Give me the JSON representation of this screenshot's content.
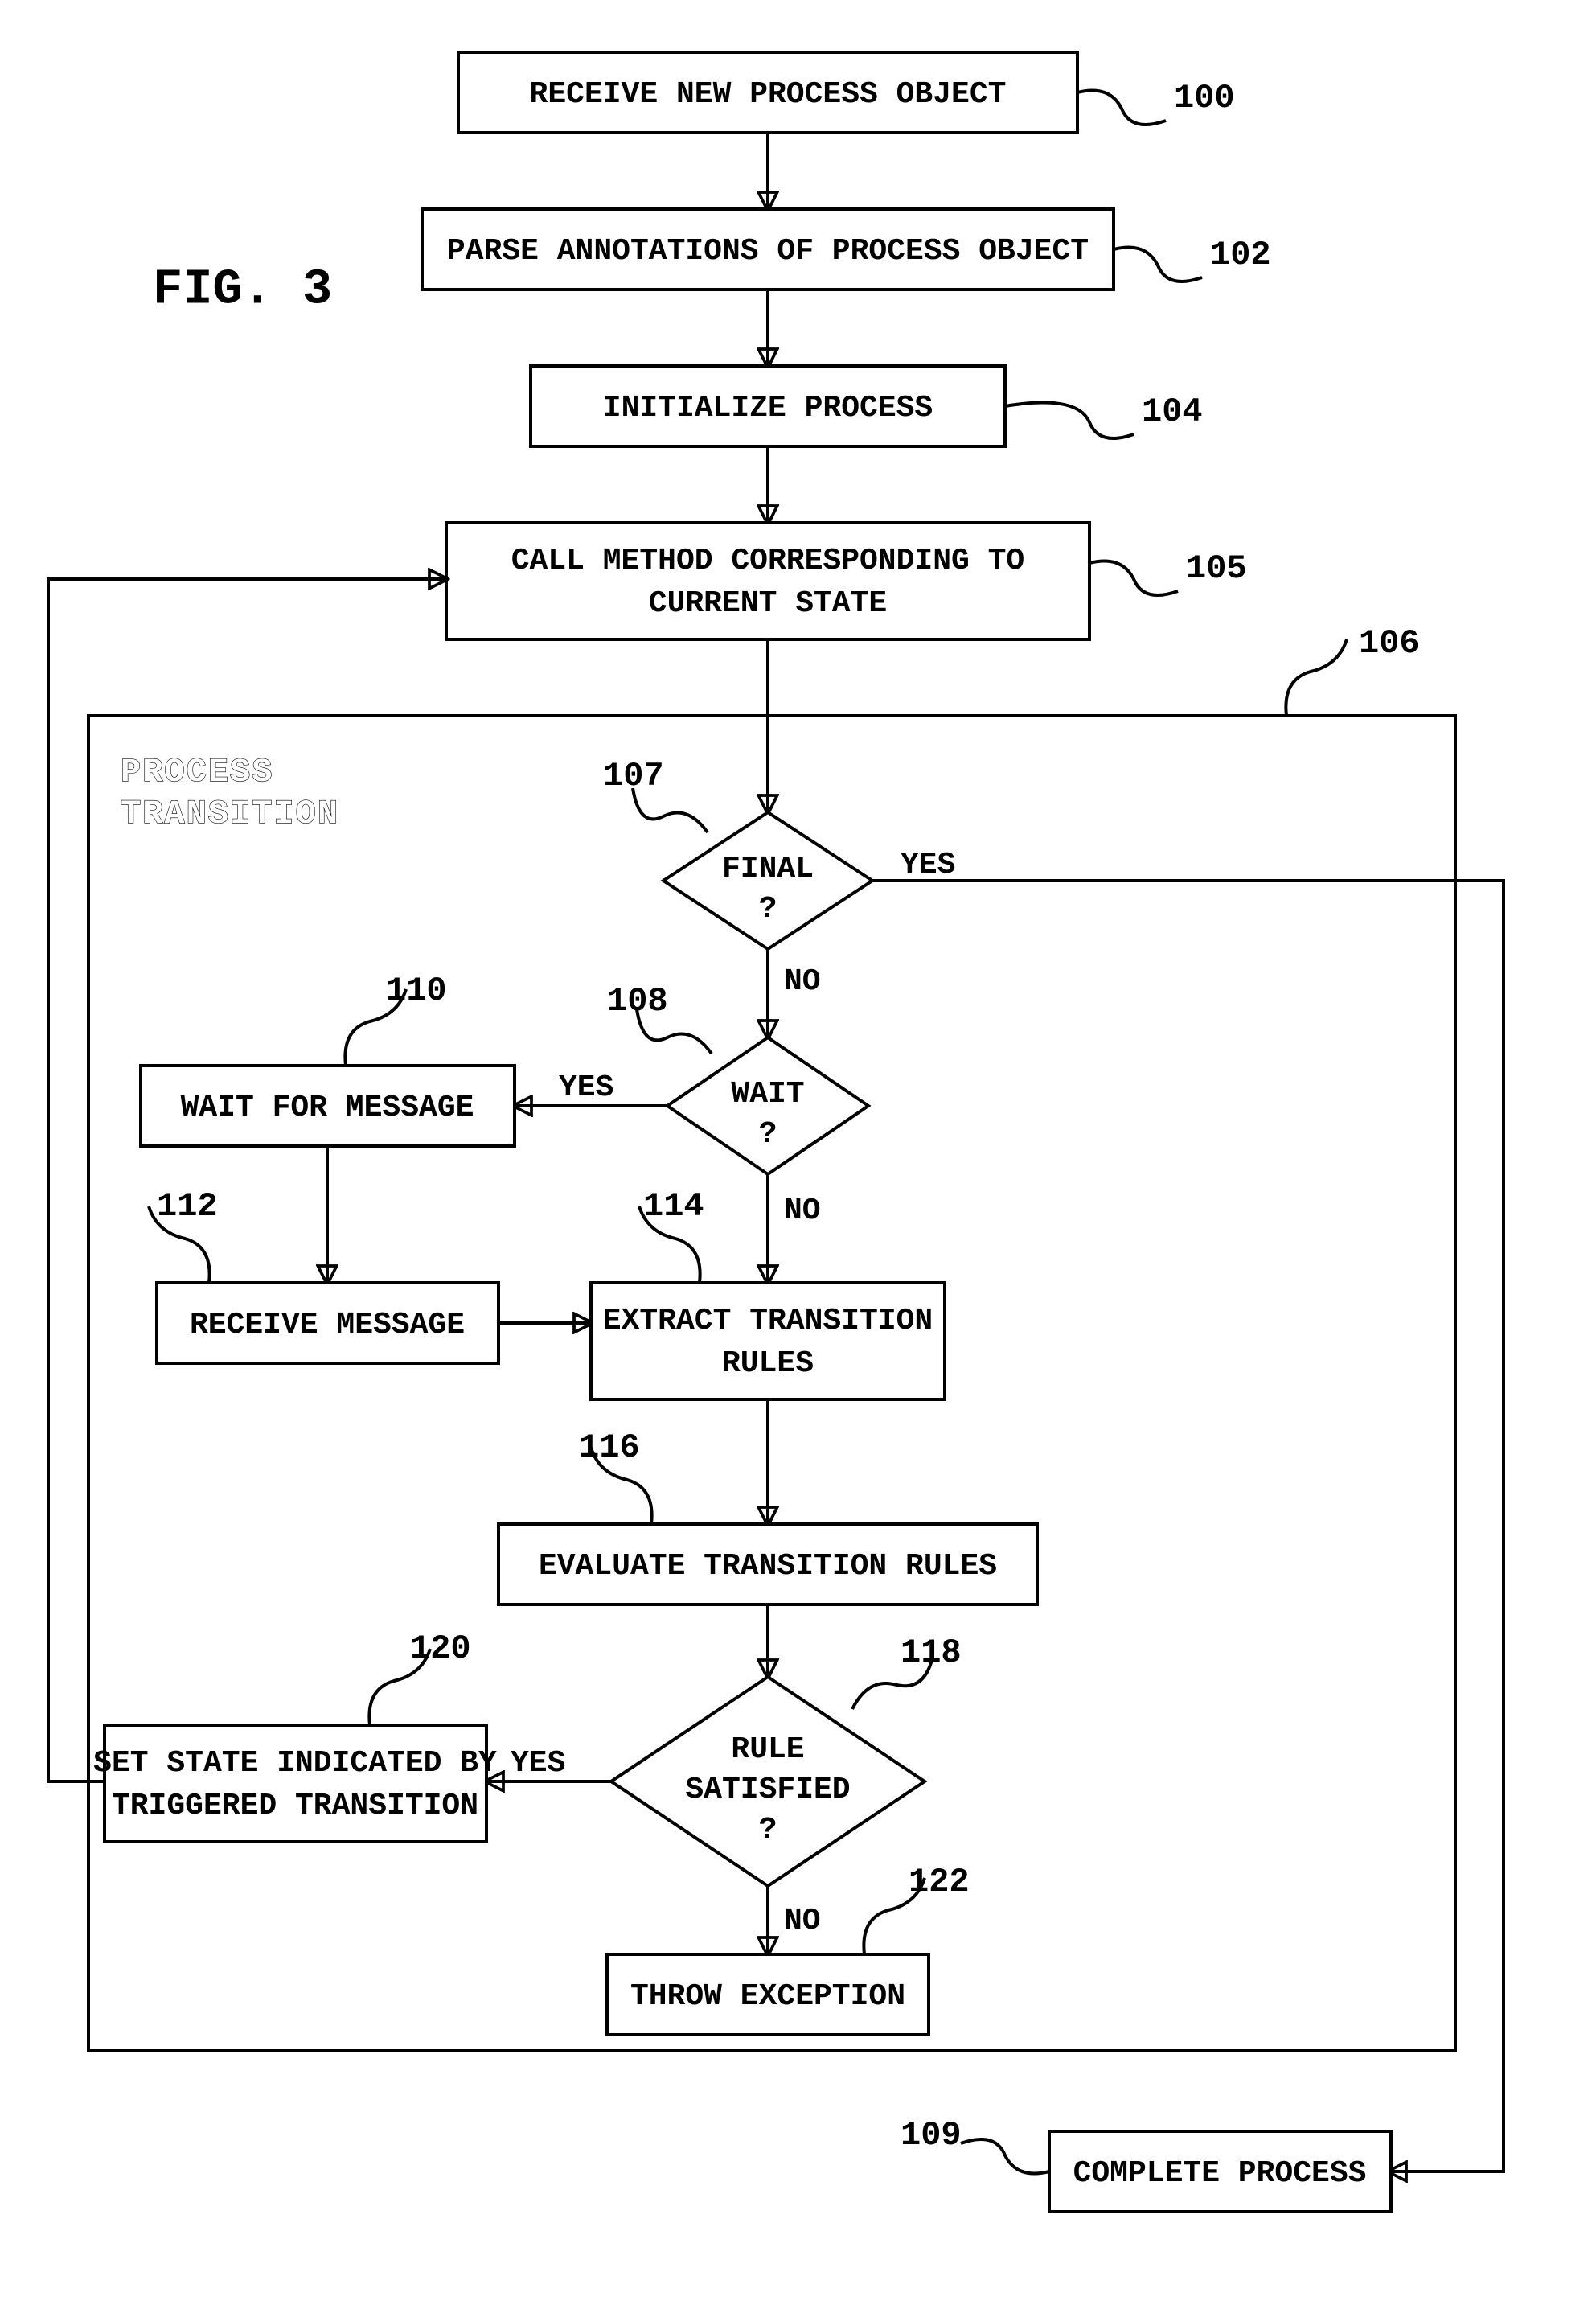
{
  "figure_label": "FIG.  3",
  "frame_label_line1": "PROCESS",
  "frame_label_line2": "TRANSITION",
  "steps": {
    "s100": {
      "ref": "100",
      "text": "RECEIVE NEW PROCESS OBJECT"
    },
    "s102": {
      "ref": "102",
      "text": "PARSE ANNOTATIONS OF PROCESS OBJECT"
    },
    "s104": {
      "ref": "104",
      "text": "INITIALIZE PROCESS"
    },
    "s105": {
      "ref": "105",
      "line1": "CALL METHOD CORRESPONDING TO",
      "line2": "CURRENT STATE"
    },
    "s106": {
      "ref": "106"
    },
    "s107": {
      "ref": "107",
      "line1": "FINAL",
      "line2": "?"
    },
    "s108": {
      "ref": "108",
      "line1": "WAIT",
      "line2": "?"
    },
    "s109": {
      "ref": "109",
      "text": "COMPLETE PROCESS"
    },
    "s110": {
      "ref": "110",
      "text": "WAIT FOR MESSAGE"
    },
    "s112": {
      "ref": "112",
      "text": "RECEIVE MESSAGE"
    },
    "s114": {
      "ref": "114",
      "line1": "EXTRACT TRANSITION",
      "line2": "RULES"
    },
    "s116": {
      "ref": "116",
      "text": "EVALUATE TRANSITION RULES"
    },
    "s118": {
      "ref": "118",
      "line1": "RULE",
      "line2": "SATISFIED",
      "line3": "?"
    },
    "s120": {
      "ref": "120",
      "line1": "SET STATE INDICATED BY",
      "line2": "TRIGGERED TRANSITION"
    },
    "s122": {
      "ref": "122",
      "text": "THROW EXCEPTION"
    }
  },
  "labels": {
    "yes": "YES",
    "no": "NO"
  }
}
